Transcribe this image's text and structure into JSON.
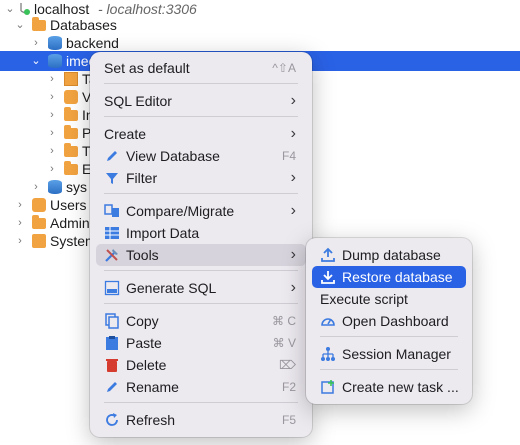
{
  "tree": {
    "connection": {
      "label": "localhost",
      "sublabel": " - localhost:3306"
    },
    "databases_label": "Databases",
    "db_backend": "backend",
    "db_selected": "imee",
    "child_table": "Ta",
    "child_view": "V",
    "child_i": "In",
    "child_p": "P",
    "child_t": "Tr",
    "child_e": "Ev",
    "db_sys": "sys",
    "users": "Users",
    "admin": "Admini",
    "system": "System"
  },
  "context_menu": {
    "set_default": "Set as default",
    "set_default_sc": "^⇧A",
    "sql_editor": "SQL Editor",
    "create": "Create",
    "view_database": "View Database",
    "view_database_sc": "F4",
    "filter": "Filter",
    "compare": "Compare/Migrate",
    "import_data": "Import Data",
    "tools": "Tools",
    "generate_sql": "Generate SQL",
    "copy": "Copy",
    "copy_sc": "⌘ C",
    "paste": "Paste",
    "paste_sc": "⌘ V",
    "delete": "Delete",
    "delete_sc": "⌦",
    "rename": "Rename",
    "rename_sc": "F2",
    "refresh": "Refresh",
    "refresh_sc": "F5"
  },
  "tools_menu": {
    "dump": "Dump database",
    "restore": "Restore database",
    "execute": "Execute script",
    "dashboard": "Open Dashboard",
    "session": "Session Manager",
    "task": "Create new task ..."
  },
  "colors": {
    "accent": "#2a62e6",
    "menu_bg": "#ece9ef",
    "folder": "#f2a341"
  }
}
